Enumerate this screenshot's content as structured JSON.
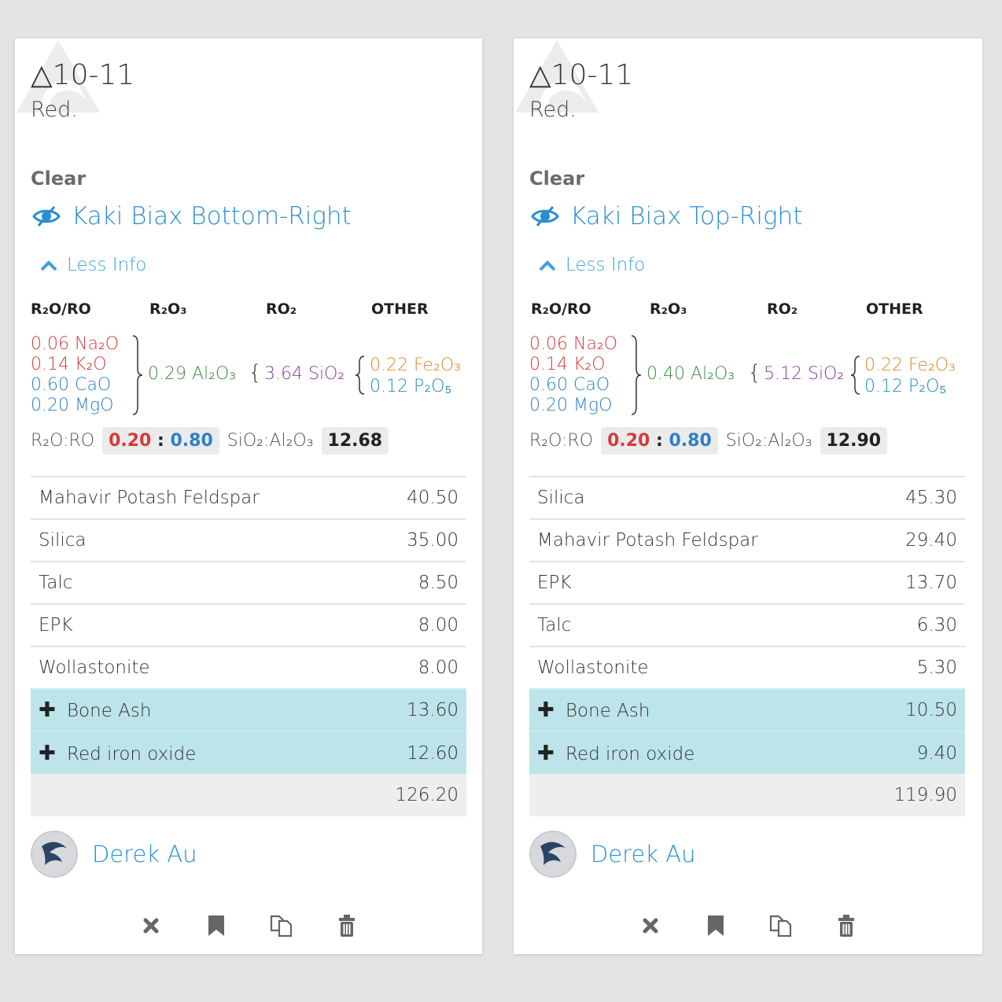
{
  "cards": [
    {
      "cone": "△10-11",
      "atmosphere": "Red.",
      "surface": "Clear",
      "recipe_name": "Kaki Biax Bottom-Right",
      "toggle_label": "Less Info",
      "umf_headers": {
        "flux": "R₂O/RO",
        "r2o3": "R₂O₃",
        "ro2": "RO₂",
        "other": "OTHER"
      },
      "flux": [
        {
          "amount": "0.06",
          "oxide": "Na₂O",
          "color": "#d33b3b"
        },
        {
          "amount": "0.14",
          "oxide": "K₂O",
          "color": "#d33b3b"
        },
        {
          "amount": "0.60",
          "oxide": "CaO",
          "color": "#2f7fc6"
        },
        {
          "amount": "0.20",
          "oxide": "MgO",
          "color": "#2f7fc6"
        }
      ],
      "al2o3": "0.29 Al₂O₃",
      "sio2": "3.64 SiO₂",
      "other": [
        "0.22 Fe₂O₃",
        "0.12 P₂O₅"
      ],
      "ratio_label": "R₂O:RO",
      "ratio_r2o": "0.20",
      "ratio_sep": ":",
      "ratio_ro": "0.80",
      "sial_label": "SiO₂:Al₂O₃",
      "sial_value": "12.68",
      "ingredients": [
        {
          "name": "Mahavir Potash Feldspar",
          "amount": "40.50"
        },
        {
          "name": "Silica",
          "amount": "35.00"
        },
        {
          "name": "Talc",
          "amount": "8.50"
        },
        {
          "name": "EPK",
          "amount": "8.00"
        },
        {
          "name": "Wollastonite",
          "amount": "8.00"
        }
      ],
      "additions": [
        {
          "name": "Bone Ash",
          "amount": "13.60"
        },
        {
          "name": "Red iron oxide",
          "amount": "12.60"
        }
      ],
      "total": "126.20",
      "author": "Derek Au"
    },
    {
      "cone": "△10-11",
      "atmosphere": "Red.",
      "surface": "Clear",
      "recipe_name": "Kaki Biax Top-Right",
      "toggle_label": "Less Info",
      "umf_headers": {
        "flux": "R₂O/RO",
        "r2o3": "R₂O₃",
        "ro2": "RO₂",
        "other": "OTHER"
      },
      "flux": [
        {
          "amount": "0.06",
          "oxide": "Na₂O",
          "color": "#d33b3b"
        },
        {
          "amount": "0.14",
          "oxide": "K₂O",
          "color": "#d33b3b"
        },
        {
          "amount": "0.60",
          "oxide": "CaO",
          "color": "#2f7fc6"
        },
        {
          "amount": "0.20",
          "oxide": "MgO",
          "color": "#2f7fc6"
        }
      ],
      "al2o3": "0.40 Al₂O₃",
      "sio2": "5.12 SiO₂",
      "other": [
        "0.22 Fe₂O₃",
        "0.12 P₂O₅"
      ],
      "ratio_label": "R₂O:RO",
      "ratio_r2o": "0.20",
      "ratio_sep": ":",
      "ratio_ro": "0.80",
      "sial_label": "SiO₂:Al₂O₃",
      "sial_value": "12.90",
      "ingredients": [
        {
          "name": "Silica",
          "amount": "45.30"
        },
        {
          "name": "Mahavir Potash Feldspar",
          "amount": "29.40"
        },
        {
          "name": "EPK",
          "amount": "13.70"
        },
        {
          "name": "Talc",
          "amount": "6.30"
        },
        {
          "name": "Wollastonite",
          "amount": "5.30"
        }
      ],
      "additions": [
        {
          "name": "Bone Ash",
          "amount": "10.50"
        },
        {
          "name": "Red iron oxide",
          "amount": "9.40"
        }
      ],
      "total": "119.90",
      "author": "Derek Au"
    }
  ],
  "icons": {
    "logo": "glazy-cone-logo",
    "visibility": "eye-slash-icon",
    "collapse": "chevron-up-icon",
    "add": "plus-icon",
    "actions": [
      "close-icon",
      "bookmark-icon",
      "copy-icon",
      "trash-icon"
    ]
  },
  "colors": {
    "link": "#2a8ed1",
    "addition_row": "#bde4ea",
    "total_row": "#eeeeee",
    "ratio_r2o": "#d33b3b",
    "ratio_ro": "#2f7fc6"
  }
}
